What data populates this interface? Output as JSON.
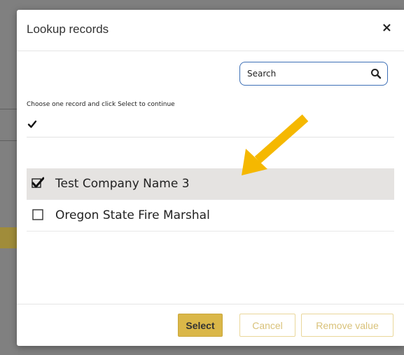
{
  "dialog": {
    "title": "Lookup records",
    "close_label": "×"
  },
  "search": {
    "placeholder": "Search",
    "icon": "search-icon"
  },
  "instructions": "Choose one record and click Select to continue",
  "records": [
    {
      "label": "Test Company Name 3",
      "selected": true
    },
    {
      "label": "Oregon State Fire Marshal",
      "selected": false
    }
  ],
  "buttons": {
    "select": "Select",
    "cancel": "Cancel",
    "remove": "Remove value"
  },
  "colors": {
    "accent": "#dab748",
    "search_border": "#3d6fb6",
    "selected_row": "#e5e3e1",
    "annotation_arrow": "#f5b800",
    "disabled_text": "#d9c27a"
  }
}
